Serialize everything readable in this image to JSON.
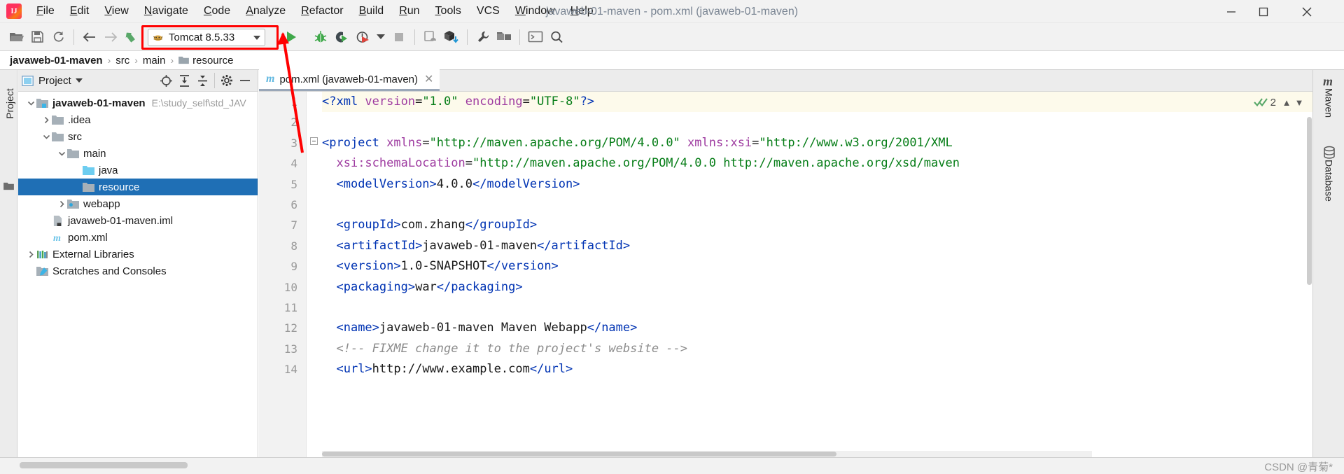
{
  "window": {
    "title": "javaweb-01-maven - pom.xml (javaweb-01-maven)",
    "minimize_label": "Minimize",
    "maximize_label": "Maximize",
    "close_label": "Close"
  },
  "menubar": {
    "logo_name": "intellij-idea-logo",
    "items": [
      {
        "mnemonic": "F",
        "rest": "ile"
      },
      {
        "mnemonic": "E",
        "rest": "dit"
      },
      {
        "mnemonic": "V",
        "rest": "iew"
      },
      {
        "mnemonic": "N",
        "rest": "avigate"
      },
      {
        "mnemonic": "C",
        "rest": "ode"
      },
      {
        "mnemonic": "A",
        "rest": "nalyze"
      },
      {
        "mnemonic": "R",
        "rest": "efactor"
      },
      {
        "mnemonic": "B",
        "rest": "uild"
      },
      {
        "mnemonic": "R",
        "rest": "un"
      },
      {
        "mnemonic": "T",
        "rest": "ools"
      },
      {
        "mnemonic": "",
        "rest": "VCS"
      },
      {
        "mnemonic": "W",
        "rest": "indow"
      },
      {
        "mnemonic": "H",
        "rest": "elp"
      }
    ]
  },
  "toolbar": {
    "open_label": "Open",
    "save_label": "Save All",
    "sync_label": "Synchronize",
    "back_label": "Back",
    "forward_label": "Forward",
    "build_label": "Build Project",
    "run_label": "Run",
    "debug_label": "Debug",
    "run_coverage_label": "Run with Coverage",
    "profiler_label": "Profiler",
    "stop_label": "Stop",
    "device_label": "Device Manager",
    "sync_gradle_label": "Sync Project",
    "settings_label": "Settings",
    "project_structure_label": "Project Structure",
    "terminal_label": "Terminal",
    "search_label": "Search Everywhere",
    "run_config": {
      "name": "Tomcat 8.5.33",
      "icon": "tomcat-icon",
      "highlight_color": "#ff0000"
    }
  },
  "breadcrumb": {
    "segments": [
      {
        "text": "javaweb-01-maven",
        "bold": true,
        "folder": false
      },
      {
        "text": "src",
        "bold": false,
        "folder": false
      },
      {
        "text": "main",
        "bold": false,
        "folder": false
      },
      {
        "text": "resource",
        "bold": false,
        "folder": true
      }
    ],
    "separator": "›"
  },
  "left_strip": {
    "project_label": "Project",
    "structure_icon": "folder-icon"
  },
  "project_panel": {
    "title": "Project",
    "view_icon": "project-view-icon",
    "locate_label": "Select Opened File",
    "expand_label": "Expand All",
    "collapse_label": "Collapse All",
    "settings_label": "Settings",
    "hide_label": "Hide",
    "tree": [
      {
        "label": "javaweb-01-maven",
        "path": "E:\\study_self\\std_JAV",
        "indent": 0,
        "twist": "down",
        "icon": "module-folder-icon",
        "bold": true,
        "selected": false
      },
      {
        "label": ".idea",
        "path": "",
        "indent": 1,
        "twist": "right",
        "icon": "folder-icon",
        "bold": false,
        "selected": false
      },
      {
        "label": "src",
        "path": "",
        "indent": 1,
        "twist": "down",
        "icon": "folder-icon",
        "bold": false,
        "selected": false
      },
      {
        "label": "main",
        "path": "",
        "indent": 2,
        "twist": "down",
        "icon": "folder-icon",
        "bold": false,
        "selected": false
      },
      {
        "label": "java",
        "path": "",
        "indent": 3,
        "twist": "none",
        "icon": "source-folder-icon",
        "bold": false,
        "selected": false
      },
      {
        "label": "resource",
        "path": "",
        "indent": 3,
        "twist": "none",
        "icon": "folder-icon",
        "bold": false,
        "selected": true
      },
      {
        "label": "webapp",
        "path": "",
        "indent": 2,
        "twist": "right",
        "icon": "web-folder-icon",
        "bold": false,
        "selected": false
      },
      {
        "label": "javaweb-01-maven.iml",
        "path": "",
        "indent": 1,
        "twist": "none",
        "icon": "iml-file-icon",
        "bold": false,
        "selected": false
      },
      {
        "label": "pom.xml",
        "path": "",
        "indent": 1,
        "twist": "none",
        "icon": "maven-file-icon",
        "bold": false,
        "selected": false
      },
      {
        "label": "External Libraries",
        "path": "",
        "indent": 0,
        "twist": "right",
        "icon": "libraries-icon",
        "bold": false,
        "selected": false
      },
      {
        "label": "Scratches and Consoles",
        "path": "",
        "indent": 0,
        "twist": "none",
        "icon": "scratches-icon",
        "bold": false,
        "selected": false
      }
    ]
  },
  "editor": {
    "tab": {
      "label": "pom.xml (javaweb-01-maven)",
      "icon": "maven-file-icon",
      "close_icon": "close-icon"
    },
    "inspection": {
      "icon": "inspection-ok-icon",
      "count": "2",
      "prev_icon": "chevron-up-icon",
      "next_icon": "chevron-down-icon"
    },
    "line_numbers": [
      "1",
      "2",
      "3",
      "4",
      "5",
      "6",
      "7",
      "8",
      "9",
      "10",
      "11",
      "12",
      "13",
      "14"
    ],
    "lines": [
      {
        "n": 1,
        "highlight": true,
        "fold": false,
        "tokens": [
          {
            "t": "tg",
            "s": "<?xml "
          },
          {
            "t": "at",
            "s": "version"
          },
          {
            "t": "eq",
            "s": "="
          },
          {
            "t": "st",
            "s": "\"1.0\""
          },
          {
            "t": "txt",
            "s": " "
          },
          {
            "t": "at",
            "s": "encoding"
          },
          {
            "t": "eq",
            "s": "="
          },
          {
            "t": "st",
            "s": "\"UTF-8\""
          },
          {
            "t": "tg",
            "s": "?>"
          }
        ]
      },
      {
        "n": 2,
        "highlight": false,
        "fold": false,
        "tokens": []
      },
      {
        "n": 3,
        "highlight": false,
        "fold": true,
        "tokens": [
          {
            "t": "tg",
            "s": "<project "
          },
          {
            "t": "at",
            "s": "xmlns"
          },
          {
            "t": "eq",
            "s": "="
          },
          {
            "t": "st",
            "s": "\"http://maven.apache.org/POM/4.0.0\""
          },
          {
            "t": "txt",
            "s": " "
          },
          {
            "t": "at",
            "s": "xmlns:xsi"
          },
          {
            "t": "eq",
            "s": "="
          },
          {
            "t": "st",
            "s": "\"http://www.w3.org/2001/XML"
          }
        ]
      },
      {
        "n": 4,
        "highlight": false,
        "fold": false,
        "tokens": [
          {
            "t": "txt",
            "s": "  "
          },
          {
            "t": "at",
            "s": "xsi:schemaLocation"
          },
          {
            "t": "eq",
            "s": "="
          },
          {
            "t": "st",
            "s": "\"http://maven.apache.org/POM/4.0.0 http://maven.apache.org/xsd/maven"
          }
        ]
      },
      {
        "n": 5,
        "highlight": false,
        "fold": false,
        "tokens": [
          {
            "t": "txt",
            "s": "  "
          },
          {
            "t": "tg",
            "s": "<modelVersion>"
          },
          {
            "t": "txt",
            "s": "4.0.0"
          },
          {
            "t": "tg",
            "s": "</modelVersion>"
          }
        ]
      },
      {
        "n": 6,
        "highlight": false,
        "fold": false,
        "tokens": []
      },
      {
        "n": 7,
        "highlight": false,
        "fold": false,
        "tokens": [
          {
            "t": "txt",
            "s": "  "
          },
          {
            "t": "tg",
            "s": "<groupId>"
          },
          {
            "t": "txt",
            "s": "com.zhang"
          },
          {
            "t": "tg",
            "s": "</groupId>"
          }
        ]
      },
      {
        "n": 8,
        "highlight": false,
        "fold": false,
        "tokens": [
          {
            "t": "txt",
            "s": "  "
          },
          {
            "t": "tg",
            "s": "<artifactId>"
          },
          {
            "t": "txt",
            "s": "javaweb-01-maven"
          },
          {
            "t": "tg",
            "s": "</artifactId>"
          }
        ]
      },
      {
        "n": 9,
        "highlight": false,
        "fold": false,
        "tokens": [
          {
            "t": "txt",
            "s": "  "
          },
          {
            "t": "tg",
            "s": "<version>"
          },
          {
            "t": "txt",
            "s": "1.0-SNAPSHOT"
          },
          {
            "t": "tg",
            "s": "</version>"
          }
        ]
      },
      {
        "n": 10,
        "highlight": false,
        "fold": false,
        "tokens": [
          {
            "t": "txt",
            "s": "  "
          },
          {
            "t": "tg",
            "s": "<packaging>"
          },
          {
            "t": "txt",
            "s": "war"
          },
          {
            "t": "tg",
            "s": "</packaging>"
          }
        ]
      },
      {
        "n": 11,
        "highlight": false,
        "fold": false,
        "tokens": []
      },
      {
        "n": 12,
        "highlight": false,
        "fold": false,
        "tokens": [
          {
            "t": "txt",
            "s": "  "
          },
          {
            "t": "tg",
            "s": "<name>"
          },
          {
            "t": "txt",
            "s": "javaweb-01-maven Maven Webapp"
          },
          {
            "t": "tg",
            "s": "</name>"
          }
        ]
      },
      {
        "n": 13,
        "highlight": false,
        "fold": false,
        "tokens": [
          {
            "t": "txt",
            "s": "  "
          },
          {
            "t": "cm",
            "s": "<!-- FIXME change it to the project's website -->"
          }
        ]
      },
      {
        "n": 14,
        "highlight": false,
        "fold": false,
        "tokens": [
          {
            "t": "txt",
            "s": "  "
          },
          {
            "t": "tg",
            "s": "<url>"
          },
          {
            "t": "txt",
            "s": "http://www.example.com"
          },
          {
            "t": "tg",
            "s": "</url>"
          }
        ]
      }
    ]
  },
  "right_strip": {
    "items": [
      {
        "label": "Maven",
        "icon": "maven-icon"
      },
      {
        "label": "Database",
        "icon": "database-icon"
      }
    ]
  },
  "bottom": {
    "watermark": "CSDN @青菊*"
  }
}
